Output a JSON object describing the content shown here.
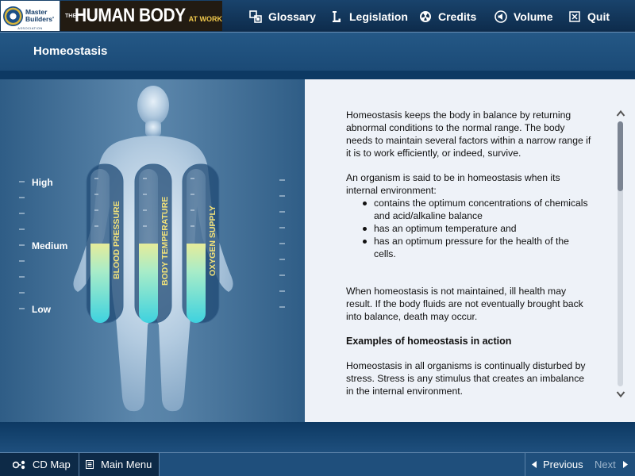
{
  "header": {
    "logo": {
      "line1": "Master",
      "line2": "Builders'",
      "assoc": "ASSOCIATION"
    },
    "app_title": {
      "prefix": "THE",
      "main": "HUMAN BODY",
      "suffix": "AT WORK"
    },
    "nav": [
      {
        "label": "Glossary",
        "icon": "glossary-icon"
      },
      {
        "label": "Legislation",
        "icon": "legislation-icon"
      },
      {
        "label": "Credits",
        "icon": "credits-icon"
      },
      {
        "label": "Volume",
        "icon": "volume-icon"
      },
      {
        "label": "Quit",
        "icon": "quit-icon"
      }
    ]
  },
  "page": {
    "title": "Homeostasis"
  },
  "diagram": {
    "scale": {
      "high": "High",
      "medium": "Medium",
      "low": "Low"
    },
    "tubes": [
      {
        "label": "BLOOD PRESSURE"
      },
      {
        "label": "BODY TEMPERATURE"
      },
      {
        "label": "OXYGEN SUPPLY"
      }
    ]
  },
  "content": {
    "p1": "Homeostasis keeps the body in balance by returning abnormal conditions to the normal range. The body needs to maintain several factors within a narrow range if it is to work efficiently, or indeed, survive.",
    "p2": "An organism is said to be in homeostasis when its internal environment:",
    "bullets": [
      "contains the optimum concentrations of chemicals and acid/alkaline balance",
      "has an optimum temperature and",
      "has an optimum pressure for the health of the cells."
    ],
    "p3": "When homeostasis is not maintained, ill health may result. If the body fluids are not eventually brought back into balance, death may occur.",
    "heading": "Examples of homeostasis in action",
    "p4": "Homeostasis in all organisms is continually disturbed by stress. Stress is any stimulus that creates an imbalance in the internal environment."
  },
  "footer": {
    "cd_map": "CD Map",
    "main_menu": "Main Menu",
    "previous": "Previous",
    "next": "Next"
  },
  "colors": {
    "header_bg": "#0d2b4b",
    "panel_blue": "#5b86ab",
    "text_panel_bg": "#eef2f8",
    "tube_fill": "#4fd6e0",
    "tube_fill_top": "#e6ec9a",
    "tube_label": "#f2e27a"
  }
}
